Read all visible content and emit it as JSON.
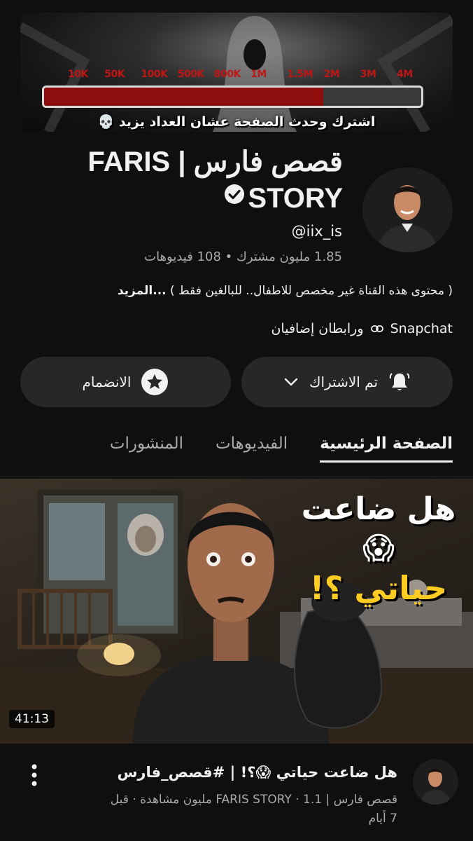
{
  "banner": {
    "ticks": [
      "10K",
      "50K",
      "100K",
      "500K",
      "800K",
      "1M",
      "1.5M",
      "2M",
      "3M",
      "4M"
    ],
    "progress": 0.74,
    "caption": "اشترك وحدث الصفحة عشان العداد يزيد 💀"
  },
  "channel": {
    "name_line1": "قصص فارس | FARIS",
    "name_line2": "STORY",
    "handle": "@iix_is",
    "subscribers": "1.85 مليون مشترك",
    "videos": "108 فيديوهات",
    "separator": "•",
    "description": "( محتوى هذه القناة غير مخصص للاطفال.. للبالغين فقط ) ",
    "more_label": "...المزيد",
    "link_label": "Snapchat",
    "extra_links": "ورابطان إضافيان"
  },
  "buttons": {
    "subscribed_label": "تم الاشتراك",
    "join_label": "الانضمام"
  },
  "tabs": [
    {
      "label": "الصفحة الرئيسية",
      "active": true
    },
    {
      "label": "الفيديوهات",
      "active": false
    },
    {
      "label": "المنشورات",
      "active": false
    }
  ],
  "video": {
    "thumb_line1": "هل ضاعت 😱",
    "thumb_line2": "حياتي ؟!",
    "duration": "41:13",
    "title": "هل ضاعت حياتي 😱؟! | #قصص_فارس",
    "meta_line1": "قصص فارس | FARIS STORY · 1.1 مليون مشاهدة · قبل",
    "meta_line2": "7 أيام"
  },
  "colors": {
    "background": "#0f0f0f",
    "button_bg": "#272727",
    "secondary_text": "#aaaaaa",
    "progress_red": "#8e0d0d",
    "tick_red": "#c01515"
  },
  "icons": {
    "verified": "check-circle-icon",
    "bell": "bell-icon",
    "chevron": "chevron-down-icon",
    "star": "star-badge-icon",
    "link": "link-icon",
    "more": "kebab-menu-icon"
  }
}
